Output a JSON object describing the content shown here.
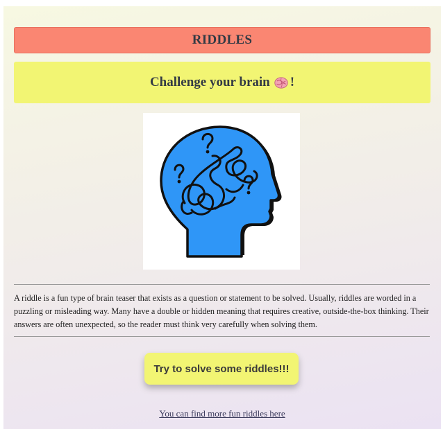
{
  "header": {
    "title": "RIDDLES"
  },
  "tagline": {
    "text": "Challenge your brain",
    "emoji_icon": "brain-emoji-icon",
    "suffix": "!"
  },
  "illustration": {
    "icon": "head-with-question-marks-icon",
    "head_color": "#2f96f7"
  },
  "description": {
    "text": "A riddle is a fun type of brain teaser that exists as a question or statement to be solved. Usually, riddles are worded in a puzzling or misleading way. Many have a double or hidden meaning that requires creative, outside-the-box thinking. Their answers are often unexpected, so the reader must think very carefully when solving them."
  },
  "cta": {
    "label": "Try to solve some riddles!!!"
  },
  "footer": {
    "link_text": "You can find more fun riddles here"
  },
  "colors": {
    "title_banner": "#fa8672",
    "tagline_banner": "#f2f573",
    "button": "#f2f573"
  }
}
